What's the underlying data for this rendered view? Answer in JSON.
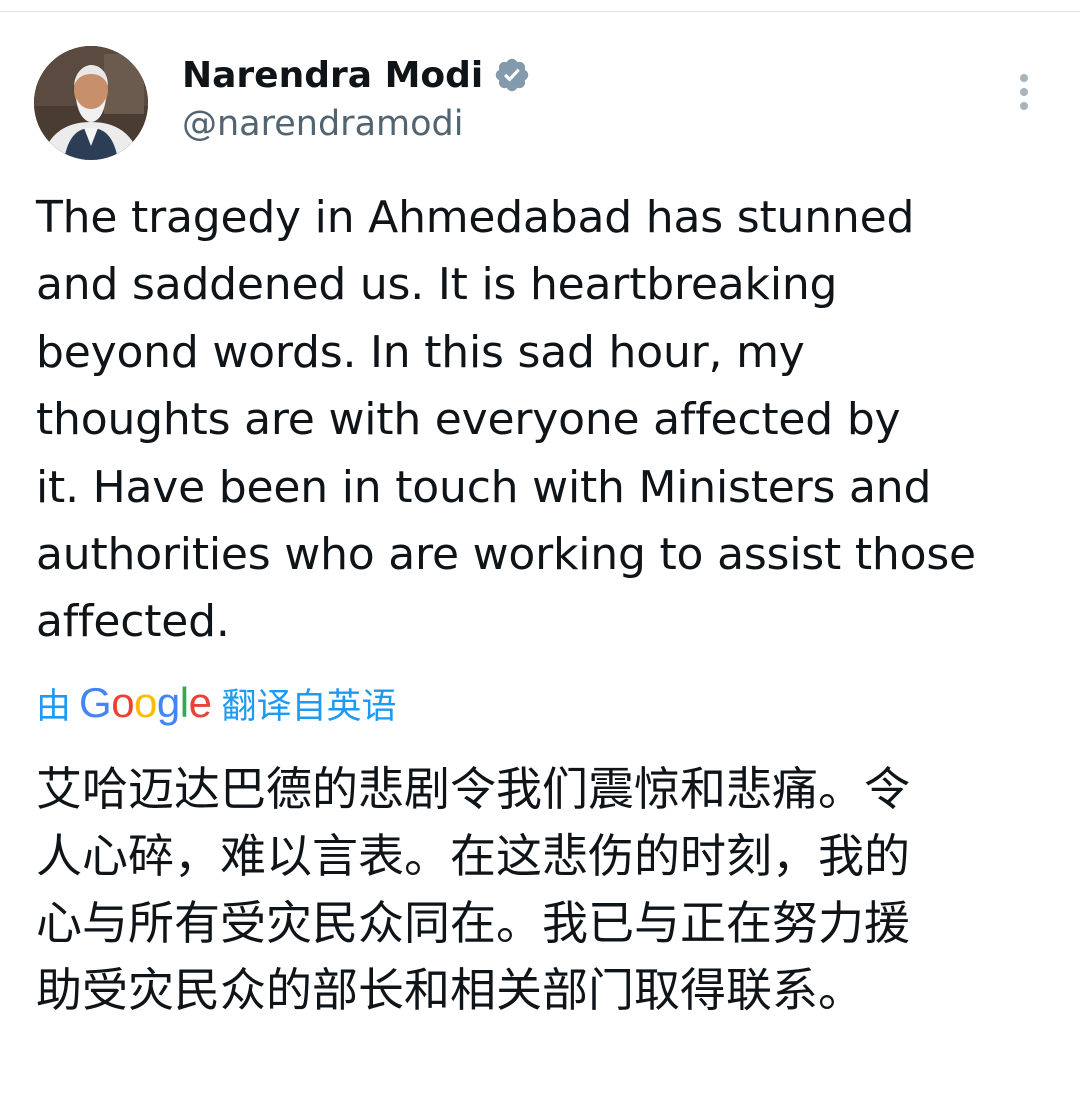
{
  "author": {
    "display_name": "Narendra Modi",
    "handle": "@narendramodi",
    "verified": true
  },
  "post": {
    "lines": [
      "The tragedy in Ahmedabad has stunned",
      "and saddened us. It is heartbreaking",
      "beyond words. In this sad hour, my",
      "thoughts are with everyone affected by",
      "it. Have been in touch with Ministers and",
      "authorities who are working to assist those",
      "affected."
    ]
  },
  "translation": {
    "prefix": "由",
    "provider": "Google",
    "suffix": "翻译自英语",
    "lines": [
      "艾哈迈达巴德的悲剧令我们震惊和悲痛。令",
      "人心碎，难以言表。在这悲伤的时刻，我的",
      "心与所有受灾民众同在。我已与正在努力援",
      "助受灾民众的部长和相关部门取得联系。"
    ]
  },
  "icons": {
    "verified": "verified-badge-icon",
    "more": "more-vertical-icon"
  },
  "colors": {
    "text": "#0f1419",
    "secondary": "#536471",
    "link": "#1d9bf0",
    "verified_badge": "#829aab"
  }
}
